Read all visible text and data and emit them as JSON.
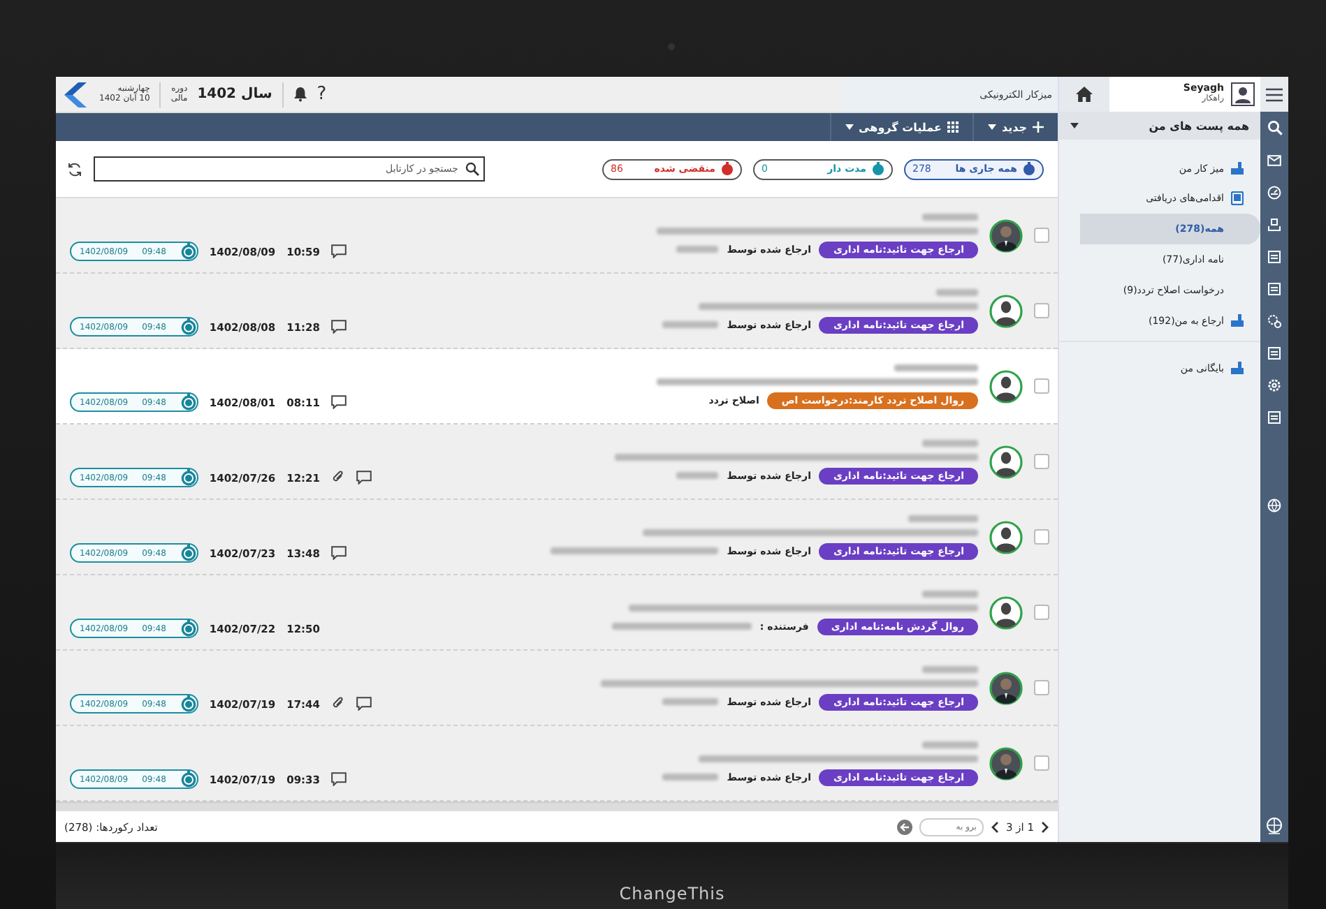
{
  "top_bar": {
    "user_name": "Seyagh",
    "user_role": "راهکار",
    "page_title": "میزکار الکترونیکی",
    "weekday": "چهارشنبه",
    "date": "10 آبان 1402",
    "period_label_1": "دوره",
    "period_label_2": "مالی",
    "fiscal_year": "سال 1402",
    "help": "?"
  },
  "sidebar": {
    "header": "همه پست های من",
    "items": [
      {
        "label": "میز کار من",
        "selected": false
      },
      {
        "label": "اقدامی‌های دریافتی",
        "selected": false,
        "children": [
          {
            "label": "همه(278)",
            "selected": true
          },
          {
            "label": "نامه اداری(77)",
            "selected": false
          },
          {
            "label": "درخواست اصلاح تردد(9)",
            "selected": false
          }
        ]
      },
      {
        "label": "ارجاع به من(192)",
        "selected": false
      },
      {
        "label": "بایگانی من",
        "selected": false
      }
    ]
  },
  "toolbar": {
    "new_button": "جدید",
    "group_actions": "عملیات گروهی"
  },
  "filters": [
    {
      "label": "همه جاری ها",
      "count": "278",
      "selected": true,
      "color": "#2f5ba8"
    },
    {
      "label": "مدت دار",
      "count": "0",
      "selected": false,
      "color": "#1795a8"
    },
    {
      "label": "منقضی شده",
      "count": "86",
      "selected": false,
      "color": "#d12f2a"
    }
  ],
  "search": {
    "placeholder": "جستجو در کارتابل"
  },
  "rows": [
    {
      "selected": false,
      "checked": false,
      "kind": "photo",
      "badge": "ارجاع جهت تائید:نامه اداری",
      "color": "#6a3fc4",
      "action": "ارجاع شده توسط",
      "date": "1402/08/09",
      "time": "10:59",
      "comment": true,
      "attachment": false,
      "due_date": "1402/08/09",
      "due_time": "09:48"
    },
    {
      "selected": false,
      "checked": false,
      "kind": "silhouette",
      "badge": "ارجاع جهت تائید:نامه اداری",
      "color": "#6a3fc4",
      "action": "ارجاع شده توسط",
      "date": "1402/08/08",
      "time": "11:28",
      "comment": true,
      "attachment": false,
      "due_date": "1402/08/09",
      "due_time": "09:48"
    },
    {
      "selected": true,
      "checked": false,
      "kind": "silhouette",
      "badge": "روال اصلاح تردد کارمند:درخواست اص",
      "color": "#d9701e",
      "action": "اصلاح تردد",
      "date": "1402/08/01",
      "time": "08:11",
      "comment": true,
      "attachment": false,
      "due_date": "1402/08/09",
      "due_time": "09:48"
    },
    {
      "selected": false,
      "checked": false,
      "kind": "silhouette",
      "badge": "ارجاع جهت تائید:نامه اداری",
      "color": "#6a3fc4",
      "action": "ارجاع شده توسط",
      "date": "1402/07/26",
      "time": "12:21",
      "comment": true,
      "attachment": true,
      "due_date": "1402/08/09",
      "due_time": "09:48"
    },
    {
      "selected": false,
      "checked": false,
      "kind": "silhouette",
      "badge": "ارجاع جهت تائید:نامه اداری",
      "color": "#6a3fc4",
      "action": "ارجاع شده توسط",
      "date": "1402/07/23",
      "time": "13:48",
      "comment": true,
      "attachment": false,
      "due_date": "1402/08/09",
      "due_time": "09:48"
    },
    {
      "selected": false,
      "checked": false,
      "kind": "silhouette",
      "badge": "روال گردش نامه:نامه اداری",
      "color": "#6a3fc4",
      "action": "فرستنده :",
      "date": "1402/07/22",
      "time": "12:50",
      "comment": false,
      "attachment": false,
      "due_date": "1402/08/09",
      "due_time": "09:48"
    },
    {
      "selected": false,
      "checked": false,
      "kind": "photo",
      "badge": "ارجاع جهت تائید:نامه اداری",
      "color": "#6a3fc4",
      "action": "ارجاع شده توسط",
      "date": "1402/07/19",
      "time": "17:44",
      "comment": true,
      "attachment": true,
      "due_date": "1402/08/09",
      "due_time": "09:48"
    },
    {
      "selected": false,
      "checked": false,
      "kind": "photo",
      "badge": "ارجاع جهت تائید:نامه اداری",
      "color": "#6a3fc4",
      "action": "ارجاع شده توسط",
      "date": "1402/07/19",
      "time": "09:33",
      "comment": true,
      "attachment": false,
      "due_date": "1402/08/09",
      "due_time": "09:48"
    }
  ],
  "footer": {
    "record_count": "تعداد رکوردها: (278)",
    "go_to_placeholder": "برو به",
    "page": "1 از 3"
  },
  "device_label": "ChangeThis"
}
